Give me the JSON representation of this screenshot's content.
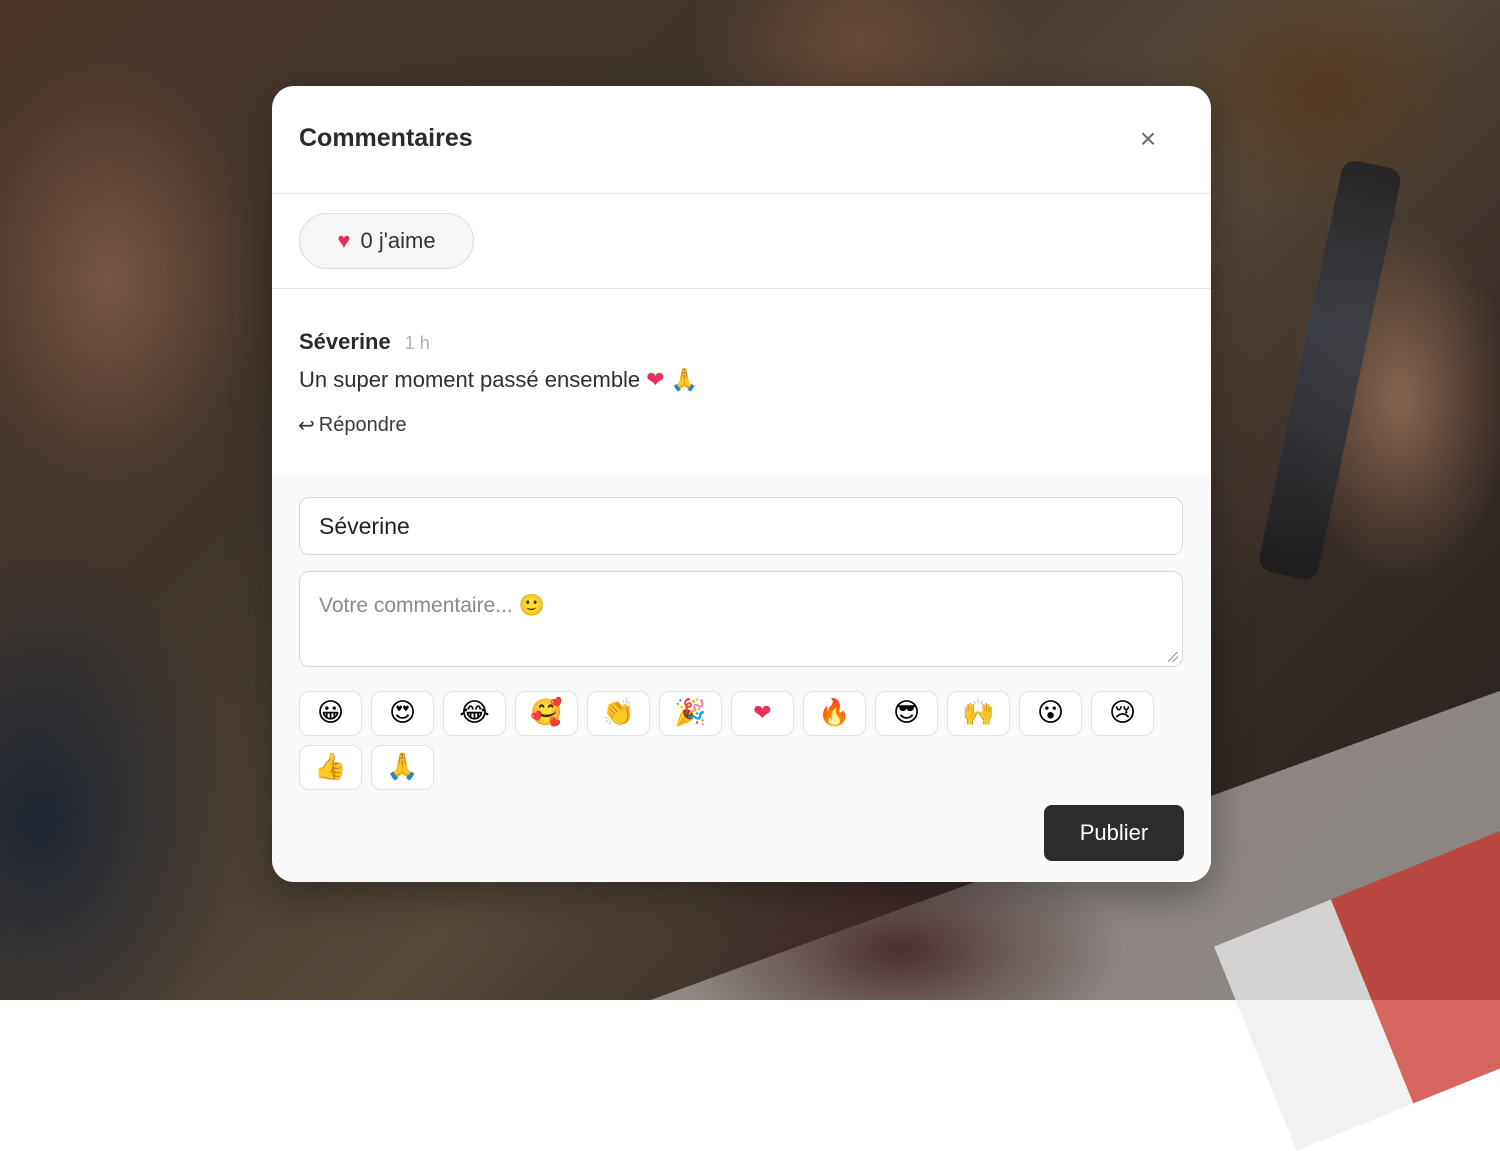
{
  "modal": {
    "title": "Commentaires",
    "close_icon": "×"
  },
  "likes": {
    "heart_icon": "♥",
    "label": "0 j'aime",
    "count": 0
  },
  "comments": [
    {
      "author": "Séverine",
      "time": "1 h",
      "text": "Un super moment passé ensemble",
      "text_emojis": "❤ 🙏",
      "reply_icon": "↩",
      "reply_label": "Répondre"
    }
  ],
  "compose": {
    "name_value": "Séverine",
    "comment_placeholder": "Votre commentaire... 🙂",
    "emojis": [
      "😀",
      "😍",
      "😂",
      "🥰",
      "👏",
      "🎉",
      "❤",
      "🔥",
      "😎",
      "🙌",
      "😮",
      "😢",
      "👍",
      "🙏"
    ],
    "publish_label": "Publier"
  },
  "colors": {
    "publish_bg": "#2c2c2c",
    "heart": "#e8315a"
  }
}
